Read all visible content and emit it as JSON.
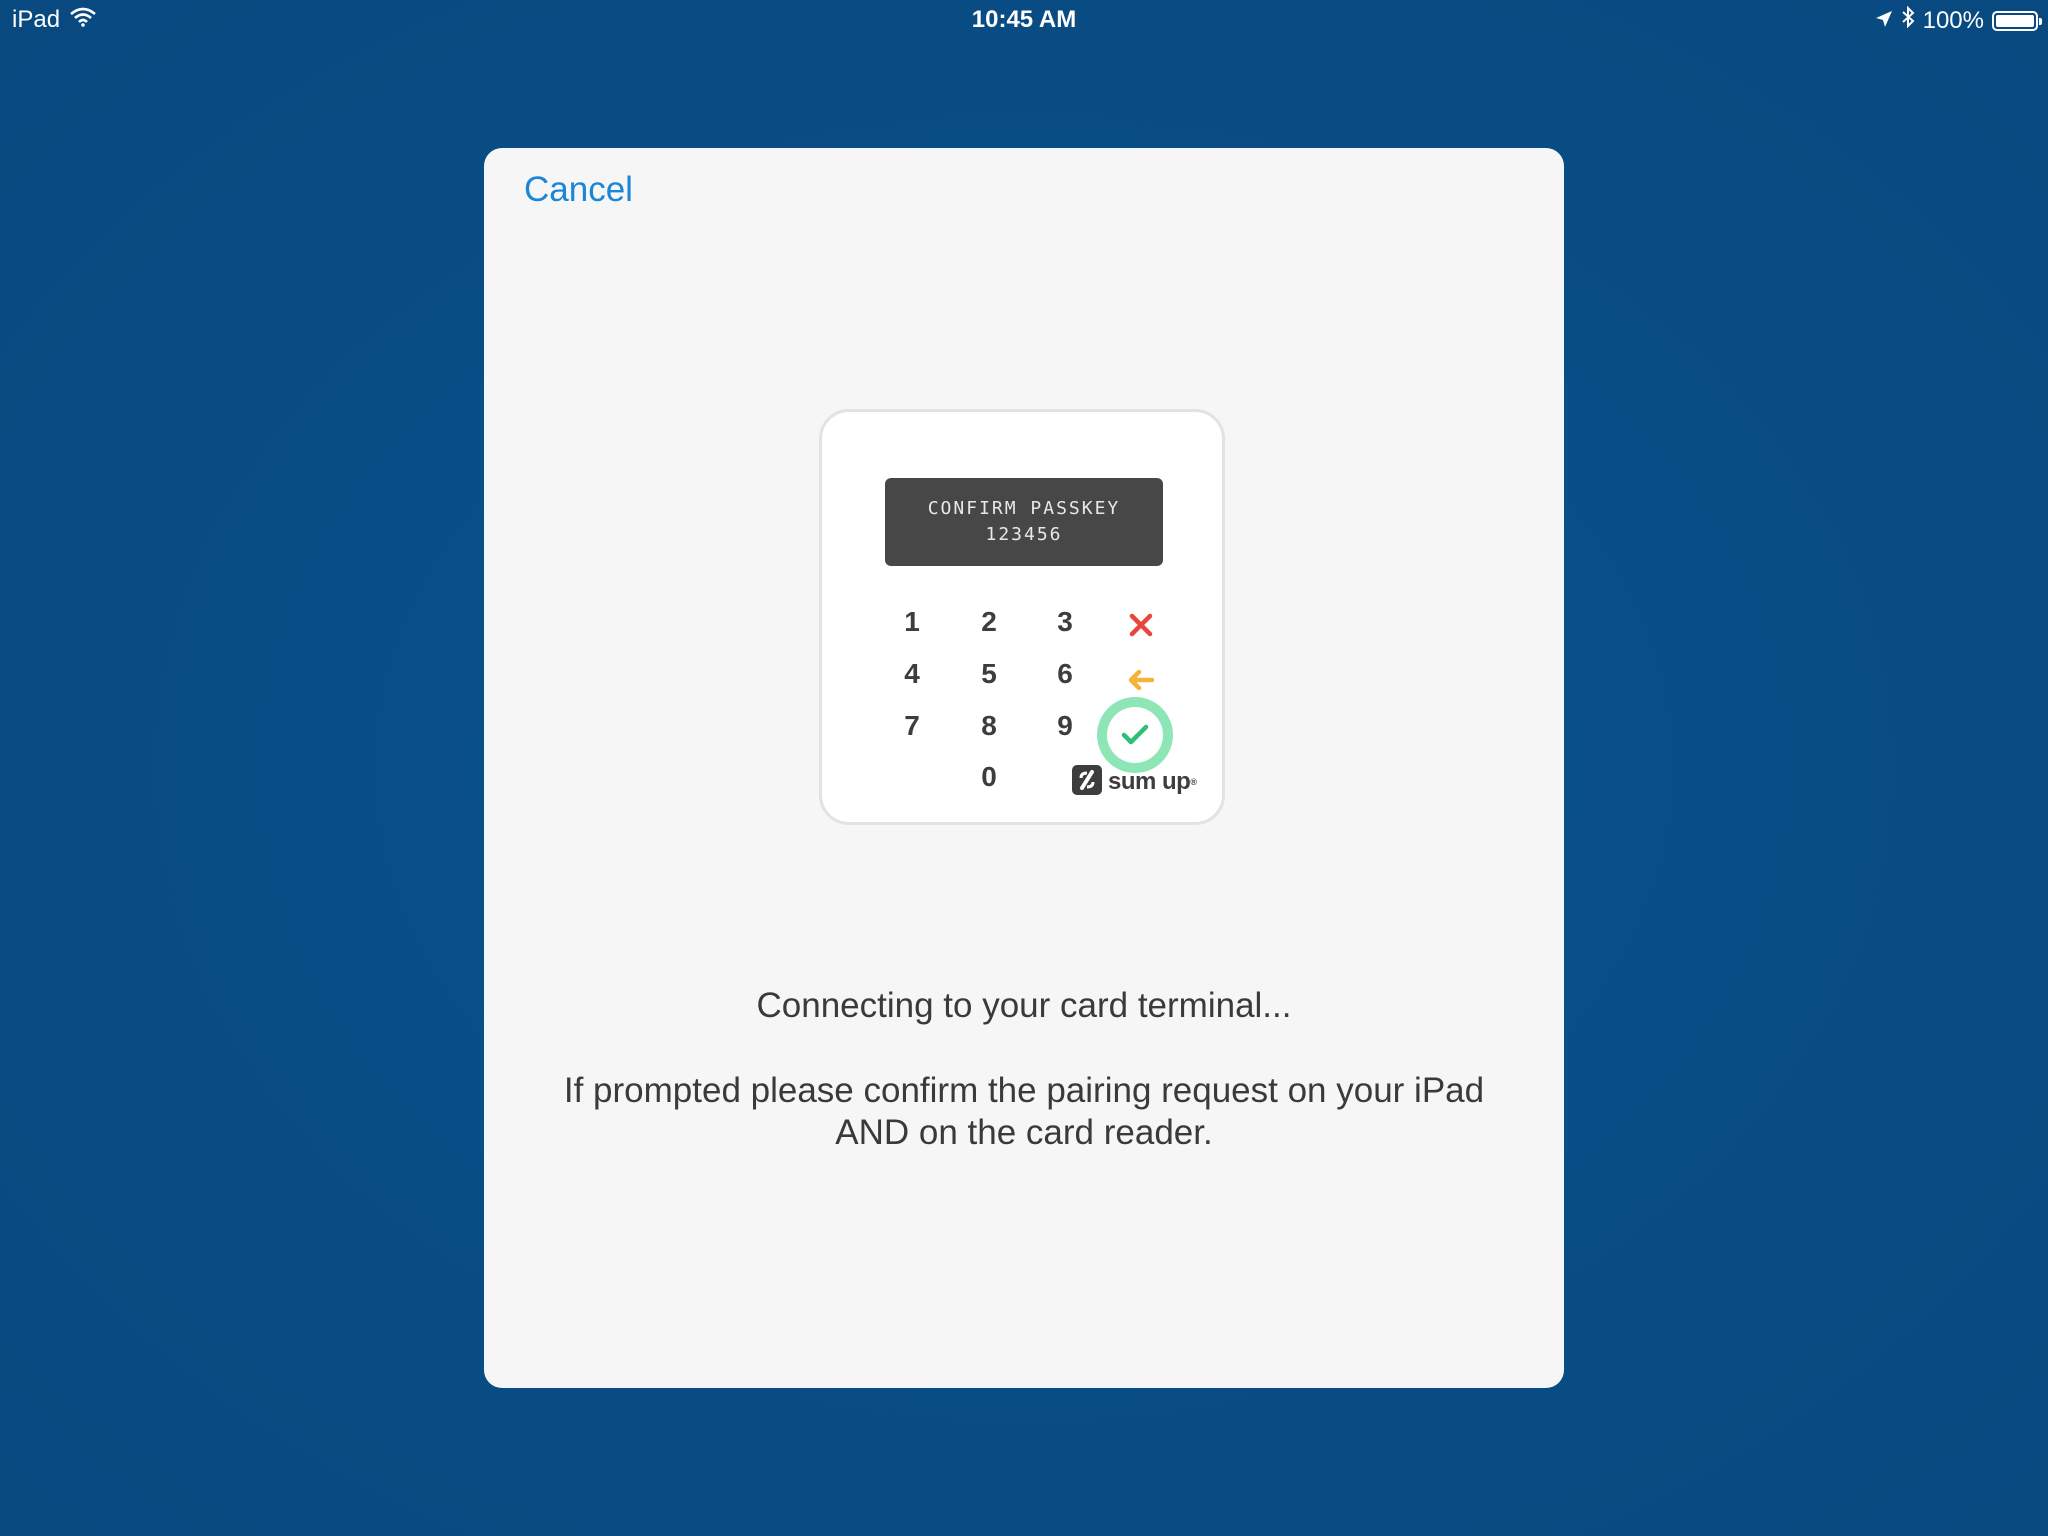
{
  "status_bar": {
    "device": "iPad",
    "time": "10:45 AM",
    "battery": "100%"
  },
  "modal": {
    "cancel_label": "Cancel",
    "title": "Connecting to your card terminal...",
    "message": "If prompted please confirm the pairing request on your iPad AND on the card reader."
  },
  "reader": {
    "screen_line1": "CONFIRM PASSKEY",
    "screen_line2": "123456",
    "keys": [
      "1",
      "2",
      "3",
      "4",
      "5",
      "6",
      "7",
      "8",
      "9",
      "0"
    ],
    "brand": "sum up",
    "brand_mark": "®",
    "colors": {
      "cancel_key": "#e8453c",
      "back_key": "#f4b43a",
      "ok_key": "#8ee6b7",
      "ok_check": "#2dbf74"
    }
  },
  "colors": {
    "background": "#0a4f87",
    "accent": "#1a86d6",
    "modal_bg": "#f6f6f6"
  },
  "icons": {
    "wifi": "wifi-icon",
    "location": "location-arrow-icon",
    "bluetooth": "bluetooth-icon",
    "battery": "battery-icon",
    "cancel_key": "close-icon",
    "back_key": "arrow-left-icon",
    "ok_key": "checkmark-icon"
  }
}
